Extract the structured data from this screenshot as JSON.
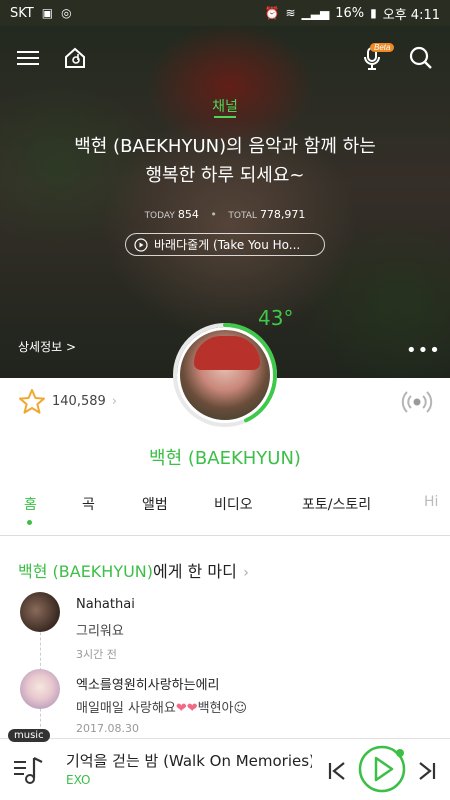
{
  "status_bar": {
    "carrier": "SKT",
    "battery": "16%",
    "time_label": "오후 4:11"
  },
  "header": {
    "beta_badge": "Beta"
  },
  "channel": {
    "label": "채널",
    "headline_line1": "백현 (BAEKHYUN)의 음악과 함께 하는",
    "headline_line2": "행복한 하루 되세요~",
    "today_label": "TODAY",
    "today_count": "854",
    "total_label": "TOTAL",
    "total_count": "778,971",
    "now_playing": "바래다줄게 (Take You Ho...",
    "detail_link": "상세정보 >"
  },
  "profile": {
    "temperature": "43°",
    "temperature_level": 0.43,
    "fan_count": "140,589",
    "artist_name": "백현 (BAEKHYUN)"
  },
  "tabs": [
    {
      "label": "홈",
      "active": true
    },
    {
      "label": "곡",
      "active": false
    },
    {
      "label": "앨범",
      "active": false
    },
    {
      "label": "비디오",
      "active": false
    },
    {
      "label": "포토/스토리",
      "active": false
    },
    {
      "label": "Hi",
      "active": false
    }
  ],
  "comments_section": {
    "title_artist": "백현 (BAEKHYUN)",
    "title_suffix": "에게 한 마디",
    "comments": [
      {
        "author": "Nahathai",
        "text": "그리워요",
        "time": "3시간 전"
      },
      {
        "author": "엑소를영원히사랑하는에리",
        "text": "매일매일 사랑해요",
        "text_tail": "백현아",
        "time": "2017.08.30"
      }
    ]
  },
  "player": {
    "tag": "music",
    "title": "기억을 걷는 밤 (Walk On Memories)",
    "artist": "EXO"
  },
  "colors": {
    "accent": "#3cbf47",
    "player_accent": "#3cbf47"
  }
}
